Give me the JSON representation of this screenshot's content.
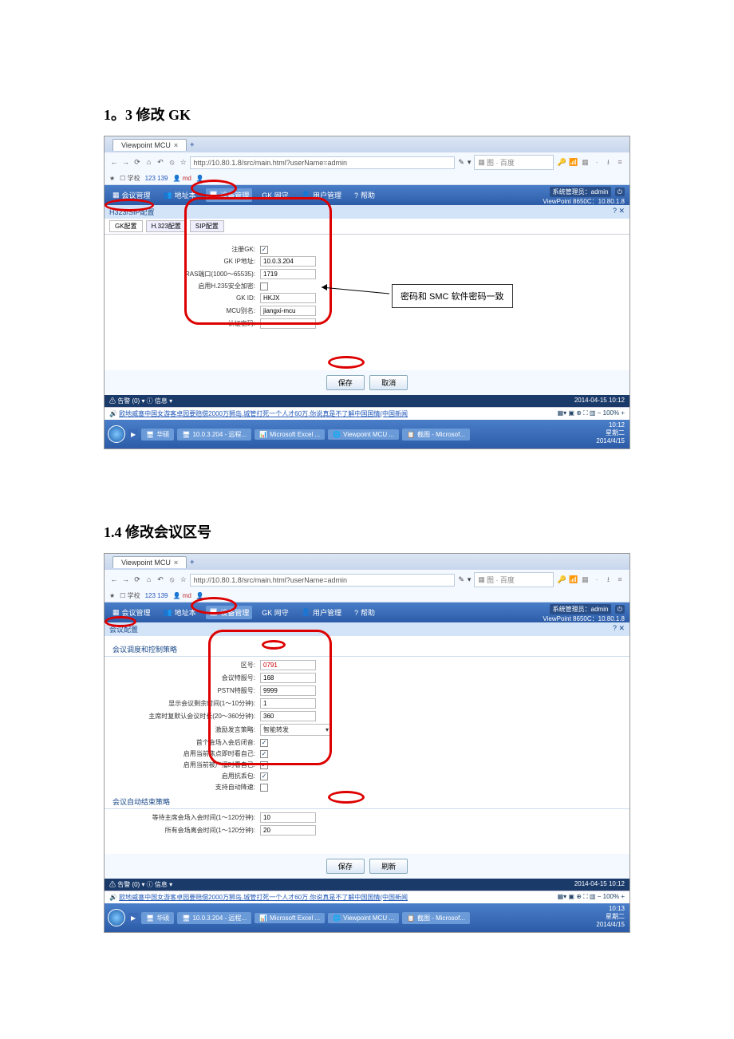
{
  "doc": {
    "h1": "1。3 修改 GK",
    "h2": "1.4 修改会议区号"
  },
  "browser": {
    "tab_title": "Viewpoint MCU",
    "url": "http://10.80.1.8/src/main.html?userName=admin",
    "search_placeholder": "图 · 百度",
    "bookmark1": "学校",
    "bookmark2": "123 139",
    "bookmark3": "md"
  },
  "nav": {
    "m1": "会议管理",
    "m2": "地址本",
    "m3": "设备管理",
    "m4": "GK 网守",
    "m5": "用户管理",
    "m6": "帮助",
    "admin": "系统管理员：admin",
    "device": "ViewPoint 8650C：10.80.1.8"
  },
  "sub1": {
    "title": "H323/SIP配置",
    "t1": "GK配置",
    "t2": "H.323配置",
    "t3": "SIP配置"
  },
  "form1": {
    "l_reg": "注册GK:",
    "l_ip": "GK IP地址:",
    "v_ip": "10.0.3.204",
    "l_ras": "RAS端口(1000～65535):",
    "v_ras": "1719",
    "l_h235": "启用H.235安全加密:",
    "l_gkid": "GK ID:",
    "v_gkid": "HKJX",
    "l_alias": "MCU别名:",
    "v_alias": "jiangxi-mcu",
    "l_pwd": "认证密码:",
    "v_pwd": "······"
  },
  "btns": {
    "save": "保存",
    "cancel": "取消",
    "refresh": "刷新"
  },
  "alert": {
    "left": "⚠ 告警 (0) ▾ ⓘ 信息 ▾",
    "time1": "2014-04-15 10:12",
    "time2": "2014-04-15 10:12",
    "news": "欧地威塞中国女游客卓园要赔偿2000万狮岛.城管打死一个人才60万.你说真是不了解中国国情(中国新闻",
    "zoom": "100%"
  },
  "task": {
    "t1": "华硕",
    "t2": "10.0.3.204 - 远程...",
    "t3": "Microsoft Excel ...",
    "t4": "Viewpoint MCU ...",
    "t5": "截图 - Microsof...",
    "clock1": "10:12",
    "clock2": "10:13",
    "day": "星期二",
    "date": "2014/4/15"
  },
  "callout1": "密码和 SMC 软件密码一致",
  "sub2": {
    "title": "会议配置",
    "sec1": "会议调度和控制策略",
    "sec2": "会议自动结束策略"
  },
  "form2": {
    "l_zone": "区号:",
    "v_zone": "0791",
    "l_conf": "会议特服号:",
    "v_conf": "168",
    "l_pstn": "PSTN特服号:",
    "v_pstn": "9999",
    "l_disp": "显示会议剩余时间(1～10分钟):",
    "v_disp": "1",
    "l_clock": "主席时复默认会议时长(20～360分钟):",
    "v_clock": "360",
    "l_policy": "激励发言策略:",
    "v_policy": "智能转发",
    "l_auto1": "首个会场入会后闭音:",
    "l_auto2": "启用当前焦点即时看自己:",
    "l_auto3": "启用当前被广播时看自己:",
    "l_auto4": "启用抗丢包:",
    "l_auto5": "支持自动降速:",
    "l_wait": "等待主席会场入会时间(1～120分钟):",
    "v_wait": "10",
    "l_all": "所有会场离会时间(1～120分钟):",
    "v_all": "20"
  }
}
